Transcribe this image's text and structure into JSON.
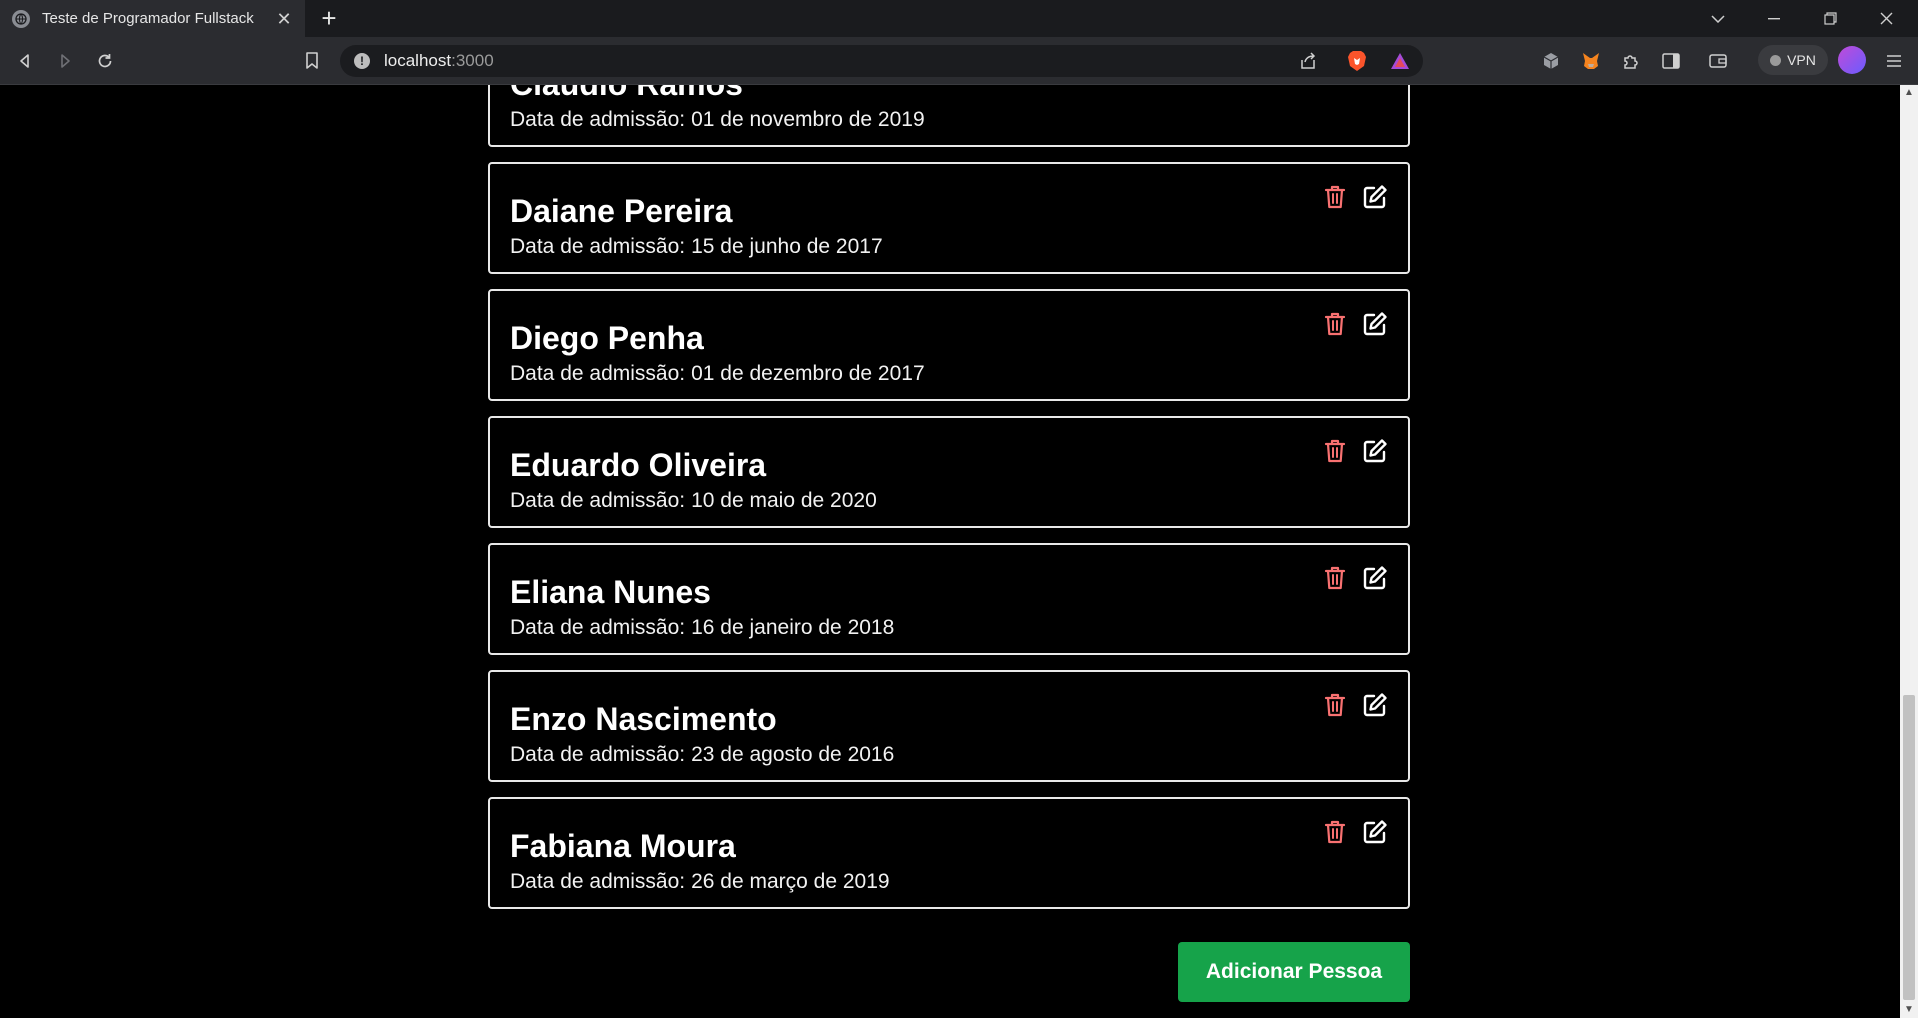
{
  "browser": {
    "tab_title": "Teste de Programador Fullstack",
    "url_host": "localhost",
    "url_port": ":3000",
    "vpn_label": "VPN"
  },
  "people": [
    {
      "name": "Cláudio Ramos",
      "date_label": "Data de admissão:",
      "date": "01 de novembro de 2019"
    },
    {
      "name": "Daiane Pereira",
      "date_label": "Data de admissão:",
      "date": "15 de junho de 2017"
    },
    {
      "name": "Diego Penha",
      "date_label": "Data de admissão:",
      "date": "01 de dezembro de 2017"
    },
    {
      "name": "Eduardo Oliveira",
      "date_label": "Data de admissão:",
      "date": "10 de maio de 2020"
    },
    {
      "name": "Eliana Nunes",
      "date_label": "Data de admissão:",
      "date": "16 de janeiro de 2018"
    },
    {
      "name": "Enzo Nascimento",
      "date_label": "Data de admissão:",
      "date": "23 de agosto de 2016"
    },
    {
      "name": "Fabiana Moura",
      "date_label": "Data de admissão:",
      "date": "26 de março de 2019"
    }
  ],
  "actions": {
    "add_label": "Adicionar Pessoa"
  },
  "colors": {
    "delete_icon": "#f87171",
    "edit_icon": "#ffffff",
    "add_button": "#16a34a",
    "card_border": "#e8e8e8",
    "page_background": "#000000"
  },
  "icons": {
    "delete": "trash-icon",
    "edit": "edit-icon"
  }
}
